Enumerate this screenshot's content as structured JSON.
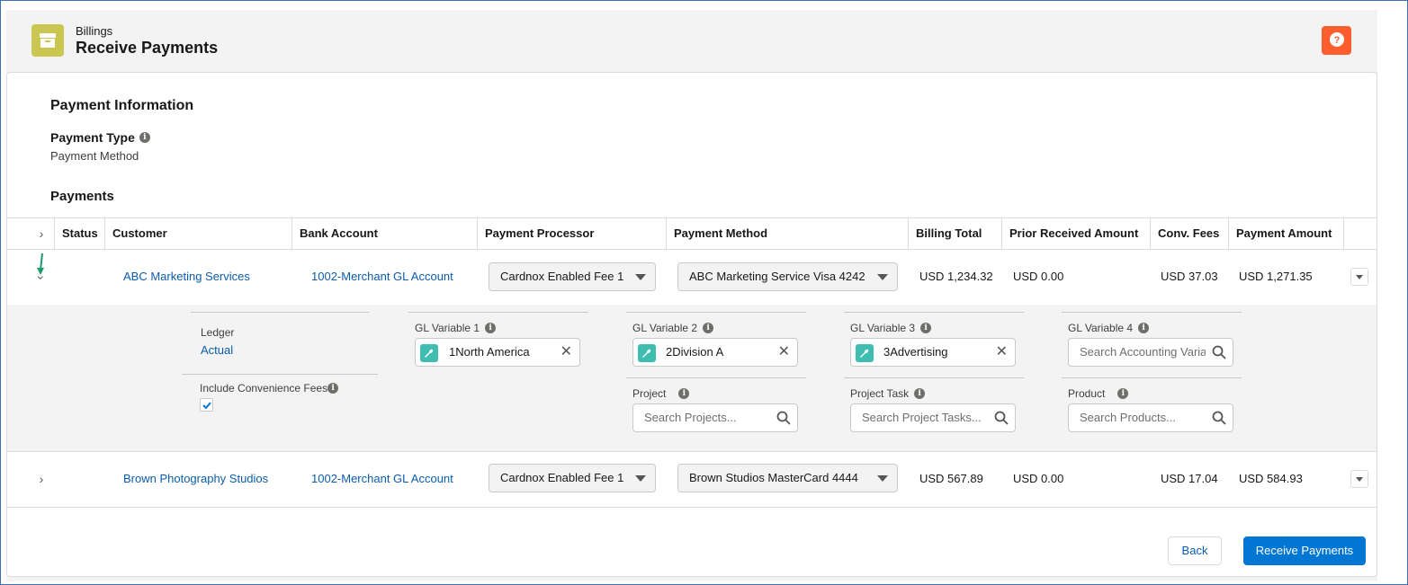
{
  "header": {
    "app_label": "Billings",
    "title": "Receive Payments"
  },
  "payment_info": {
    "section_title": "Payment Information",
    "payment_type_label": "Payment Type",
    "payment_type_value": "Payment Method",
    "payments_title": "Payments"
  },
  "table": {
    "columns": [
      "Status",
      "Customer",
      "Bank Account",
      "Payment Processor",
      "Payment Method",
      "Billing Total",
      "Prior Received Amount",
      "Conv. Fees",
      "Payment Amount"
    ],
    "rows": [
      {
        "customer": "ABC Marketing Services",
        "bank_account": "1002-Merchant GL Account",
        "processor": "Cardnox Enabled Fee 1",
        "method": "ABC Marketing Service Visa 4242",
        "billing_total": "USD 1,234.32",
        "prior_received": "USD 0.00",
        "conv_fees": "USD 37.03",
        "payment_amount": "USD 1,271.35"
      },
      {
        "customer": "Brown Photography Studios",
        "bank_account": "1002-Merchant GL Account",
        "processor": "Cardnox Enabled Fee 1",
        "method": "Brown Studios MasterCard 4444",
        "billing_total": "USD 567.89",
        "prior_received": "USD 0.00",
        "conv_fees": "USD 17.04",
        "payment_amount": "USD 584.93"
      }
    ]
  },
  "details": {
    "ledger_label": "Ledger",
    "ledger_value": "Actual",
    "conv_fees_label": "Include Convenience Fees",
    "conv_fees_checked": true,
    "gl1_label": "GL Variable 1",
    "gl1_value": "1North America",
    "gl2_label": "GL Variable 2",
    "gl2_value": "2Division A",
    "gl3_label": "GL Variable 3",
    "gl3_value": "3Advertising",
    "gl4_label": "GL Variable 4",
    "gl4_placeholder": "Search Accounting Varia",
    "project_label": "Project",
    "project_placeholder": "Search Projects...",
    "project_task_label": "Project Task",
    "project_task_placeholder": "Search Project Tasks...",
    "product_label": "Product",
    "product_placeholder": "Search Products..."
  },
  "footer": {
    "back_label": "Back",
    "receive_label": "Receive Payments"
  },
  "colors": {
    "brand_blue": "#0176d3",
    "link_blue": "#0b5cab",
    "help_orange": "#ff5d2d",
    "app_icon": "#c9c74f",
    "pill_icon": "#3ebdb0"
  }
}
